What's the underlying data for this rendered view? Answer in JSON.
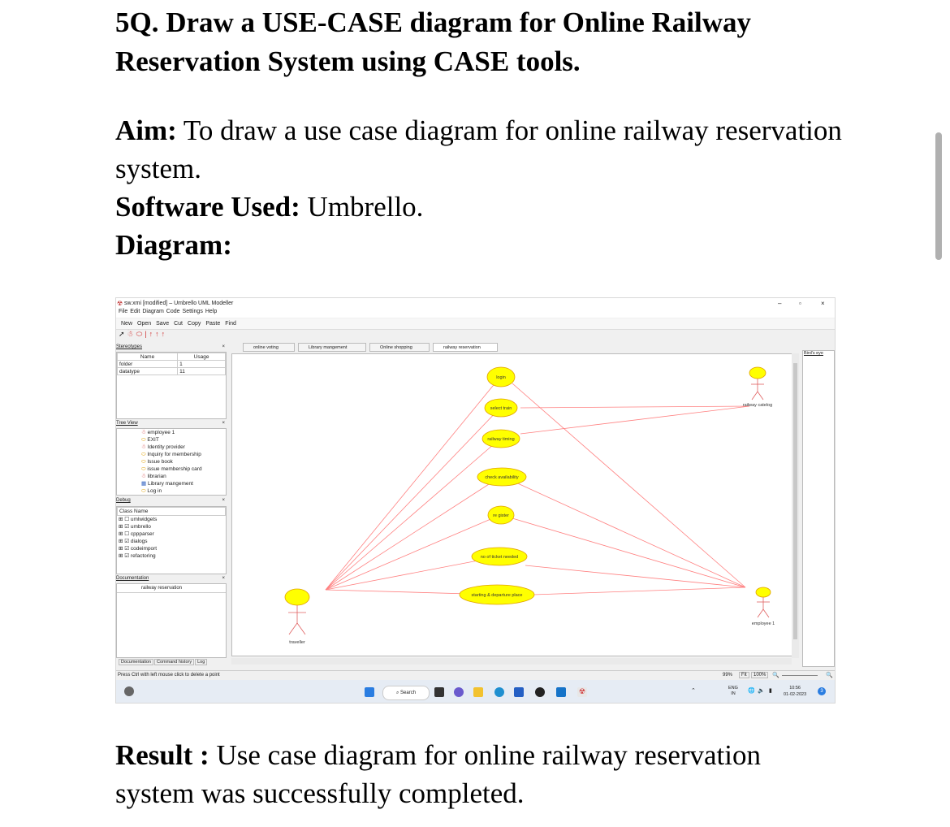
{
  "document": {
    "question_title": "5Q. Draw a USE-CASE diagram for Online Railway Reservation System using CASE tools.",
    "aim_label": "Aim:",
    "aim_text": " To draw a use case diagram for online railway reservation system.",
    "software_label": "Software Used:",
    "software_text": " Umbrello.",
    "diagram_label": "Diagram:",
    "result_label": "Result :",
    "result_text": " Use case diagram for online railway reservation system was successfully completed."
  },
  "screenshot": {
    "window_title": "sw.xmi [modified] – Umbrello UML Modeller",
    "window_controls": [
      "–",
      "▫",
      "×"
    ],
    "menu": [
      "File",
      "Edit",
      "Diagram",
      "Code",
      "Settings",
      "Help"
    ],
    "toolbar": [
      "New",
      "Open",
      "Save",
      "Cut",
      "Copy",
      "Paste",
      "Find"
    ],
    "stereotypes": {
      "title": "Stereotypes",
      "columns": [
        "Name",
        "Usage"
      ],
      "rows": [
        [
          "folder",
          "1"
        ],
        [
          "datatype",
          "11"
        ]
      ]
    },
    "tree_view": {
      "title": "Tree View",
      "items": [
        "employee 1",
        "EXIT",
        "Identity provider",
        "Inquiry for membership",
        "Issue book",
        "issue membership card",
        "librarian",
        "Library mangement",
        "Log in"
      ]
    },
    "debug": {
      "title": "Debug",
      "header": "Class Name",
      "items": [
        {
          "label": "umlwidgets",
          "checked": false
        },
        {
          "label": "umbrello",
          "checked": true
        },
        {
          "label": "cppparser",
          "checked": false
        },
        {
          "label": "dialogs",
          "checked": true
        },
        {
          "label": "codeimport",
          "checked": true
        },
        {
          "label": "refactoring",
          "checked": true
        }
      ]
    },
    "documentation": {
      "title": "Documentation",
      "field": "railway reservation"
    },
    "bottom_tabs": [
      "Documentation",
      "Command history",
      "Log"
    ],
    "diagram_tabs": [
      "online voting",
      "Library mangement",
      "Online shopping",
      "railway reservation"
    ],
    "birds_eye_title": "Bird's eye",
    "use_cases": [
      "login",
      "select train",
      "railway timing",
      "check availability",
      "re gister",
      "no of ticket needed",
      "starting & departure place"
    ],
    "actors": [
      "railway catelog",
      "traveller",
      "employee 1"
    ],
    "status_text": "Press Ctrl with left mouse click to delete a point",
    "zoom": "99%",
    "fit_label": "Fit",
    "zoom_100": "100%",
    "taskbar": {
      "search": "Search",
      "lang": "ENG",
      "region": "IN",
      "time": "10:56",
      "date": "01-02-2023",
      "notif": "3"
    }
  }
}
